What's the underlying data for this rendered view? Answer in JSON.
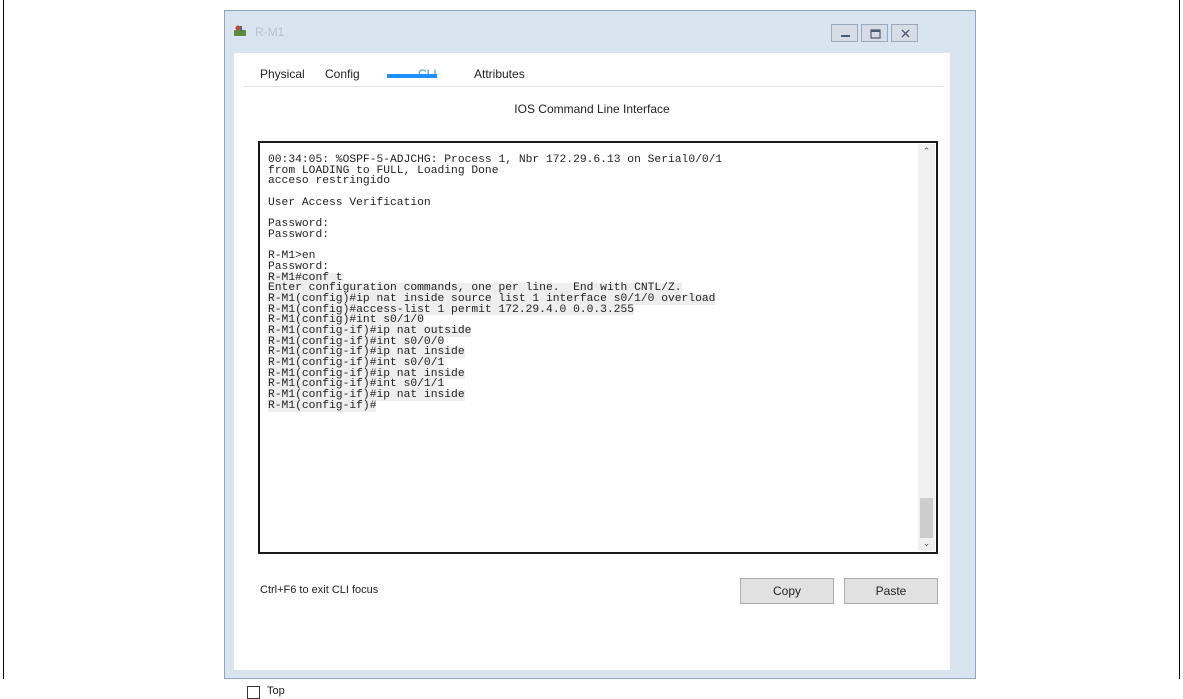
{
  "window": {
    "title": "R-M1",
    "icon": "router-icon"
  },
  "tabs": [
    {
      "label": "Physical"
    },
    {
      "label": "Config"
    },
    {
      "label": "CLI"
    },
    {
      "label": "Attributes"
    }
  ],
  "active_tab": "CLI",
  "panel_title": "IOS Command Line Interface",
  "terminal": {
    "lines": [
      "00:34:05: %OSPF-5-ADJCHG: Process 1, Nbr 172.29.6.13 on Serial0/0/1",
      "from LOADING to FULL, Loading Done",
      "acceso restringido",
      "",
      "User Access Verification",
      "",
      "Password:",
      "Password:",
      "",
      "R-M1>en",
      "Password:",
      "R-M1#conf t",
      "Enter configuration commands, one per line.  End with CNTL/Z.",
      "R-M1(config)#ip nat inside source list 1 interface s0/1/0 overload",
      "R-M1(config)#access-list 1 permit 172.29.4.0 0.0.3.255",
      "R-M1(config)#int s0/1/0",
      "R-M1(config-if)#ip nat outside",
      "R-M1(config-if)#int s0/0/0",
      "R-M1(config-if)#ip nat inside",
      "R-M1(config-if)#int s0/0/1",
      "R-M1(config-if)#ip nat inside",
      "R-M1(config-if)#int s0/1/1",
      "R-M1(config-if)#ip nat inside",
      "R-M1(config-if)#"
    ]
  },
  "footer": {
    "hint": "Ctrl+F6 to exit CLI focus",
    "copy_label": "Copy",
    "paste_label": "Paste"
  },
  "top_checkbox": {
    "label": "Top",
    "checked": false
  },
  "colors": {
    "accent": "#1e90ff",
    "active_tab_text": "#4a8ed6",
    "window_frame": "#d9e4f1"
  }
}
